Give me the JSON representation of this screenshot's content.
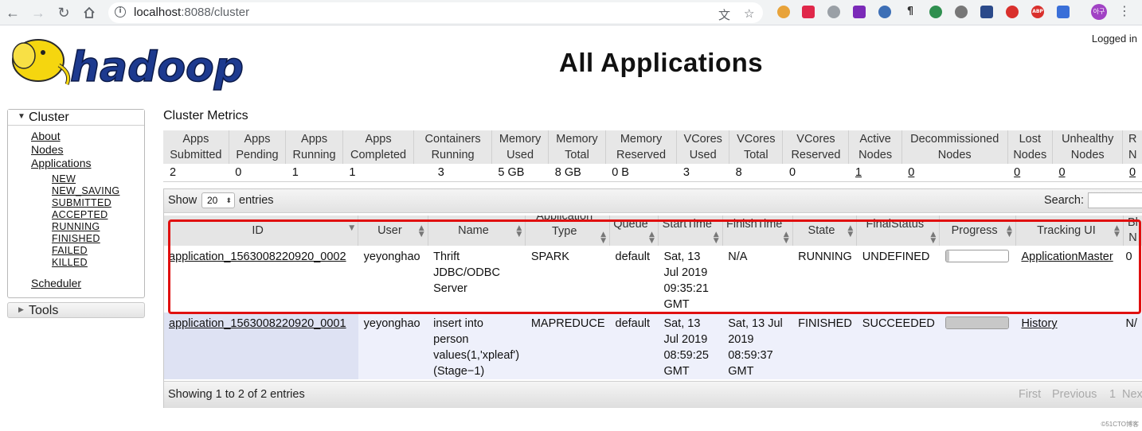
{
  "browser": {
    "url_host": "localhost",
    "url_rest": ":8088/cluster",
    "profile_initials": "아구"
  },
  "header": {
    "logo_text": "hadoop",
    "title": "All Applications",
    "logged_in": "Logged in"
  },
  "sidebar": {
    "cluster_label": "Cluster",
    "links": [
      "About",
      "Nodes",
      "Applications"
    ],
    "states": [
      "NEW",
      "NEW_SAVING",
      "SUBMITTED",
      "ACCEPTED",
      "RUNNING",
      "FINISHED",
      "FAILED",
      "KILLED"
    ],
    "scheduler": "Scheduler",
    "tools_label": "Tools"
  },
  "metrics": {
    "title": "Cluster Metrics",
    "headers": [
      [
        "Apps",
        "Submitted"
      ],
      [
        "Apps",
        "Pending"
      ],
      [
        "Apps",
        "Running"
      ],
      [
        "Apps",
        "Completed"
      ],
      [
        "Containers",
        "Running"
      ],
      [
        "Memory",
        "Used"
      ],
      [
        "Memory",
        "Total"
      ],
      [
        "Memory",
        "Reserved"
      ],
      [
        "VCores",
        "Used"
      ],
      [
        "VCores",
        "Total"
      ],
      [
        "VCores",
        "Reserved"
      ],
      [
        "Active",
        "Nodes"
      ],
      [
        "Decommissioned",
        "Nodes"
      ],
      [
        "Lost",
        "Nodes"
      ],
      [
        "Unhealthy",
        "Nodes"
      ],
      [
        "R",
        "N"
      ]
    ],
    "values": [
      "2",
      "0",
      "1",
      "1",
      "3",
      "5 GB",
      "8 GB",
      "0 B",
      "3",
      "8",
      "0",
      "1",
      "0",
      "0",
      "0",
      "0"
    ]
  },
  "apps": {
    "show_label": "Show",
    "page_size": "20",
    "entries_label": "entries",
    "search_label": "Search:",
    "columns": [
      [
        "ID"
      ],
      [
        "User"
      ],
      [
        "Name"
      ],
      [
        "Application",
        "Type"
      ],
      [
        "Queue"
      ],
      [
        "StartTime"
      ],
      [
        "FinishTime"
      ],
      [
        "State"
      ],
      [
        "FinalStatus"
      ],
      [
        "Progress"
      ],
      [
        "Tracking UI"
      ],
      [
        "Bl",
        "N"
      ]
    ],
    "rows": [
      {
        "id": "application_1563008220920_0002",
        "user": "yeyonghao",
        "name": "Thrift JDBC/ODBC Server",
        "type": "SPARK",
        "queue": "default",
        "start": "Sat, 13 Jul 2019 09:35:21 GMT",
        "finish": "N/A",
        "state": "RUNNING",
        "final_status": "UNDEFINED",
        "progress": 0.05,
        "tracking": "ApplicationMaster",
        "blacklisted": "0"
      },
      {
        "id": "application_1563008220920_0001",
        "user": "yeyonghao",
        "name": "insert into person values(1,'xpleaf') (Stage−1)",
        "type": "MAPREDUCE",
        "queue": "default",
        "start": "Sat, 13 Jul 2019 08:59:25 GMT",
        "finish": "Sat, 13 Jul 2019 08:59:37 GMT",
        "state": "FINISHED",
        "final_status": "SUCCEEDED",
        "progress": 1.0,
        "tracking": "History",
        "blacklisted": "N/"
      }
    ],
    "footer_info": "Showing 1 to 2 of 2 entries",
    "pager": [
      "First",
      "Previous",
      "1",
      "Next"
    ]
  },
  "watermark": "©51CTO博客"
}
